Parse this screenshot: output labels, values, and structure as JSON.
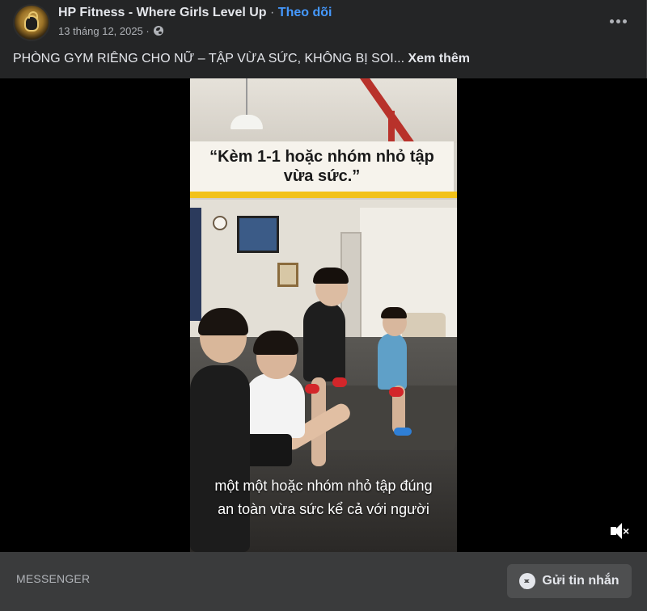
{
  "post": {
    "page_name": "HP Fitness - Where Girls Level Up",
    "separator": "·",
    "follow_label": "Theo dõi",
    "date": "13 tháng 12, 2025 ·",
    "audience_icon": "globe-icon",
    "more_icon": "more-horizontal-icon",
    "caption": "PHÒNG GYM RIÊNG CHO NỮ – TẬP VỪA SỨC, KHÔNG BỊ SOI...",
    "see_more_label": "Xem thêm"
  },
  "video": {
    "title_card": "“Kèm 1-1 hoặc nhóm nhỏ tập vừa sức.”",
    "subtitle_line1": "một một hoặc nhóm nhỏ tập đúng",
    "subtitle_line2": "an toàn vừa sức kể cả với người",
    "mute_icon": "speaker-muted-icon",
    "accent_color": "#f2c21a"
  },
  "footer": {
    "label": "MESSENGER",
    "send_button_label": "Gửi tin nhắn",
    "send_button_icon": "messenger-icon"
  },
  "colors": {
    "background": "#242526",
    "link": "#4599ff",
    "text": "#e4e6eb",
    "secondary_text": "#b0b3b8"
  }
}
